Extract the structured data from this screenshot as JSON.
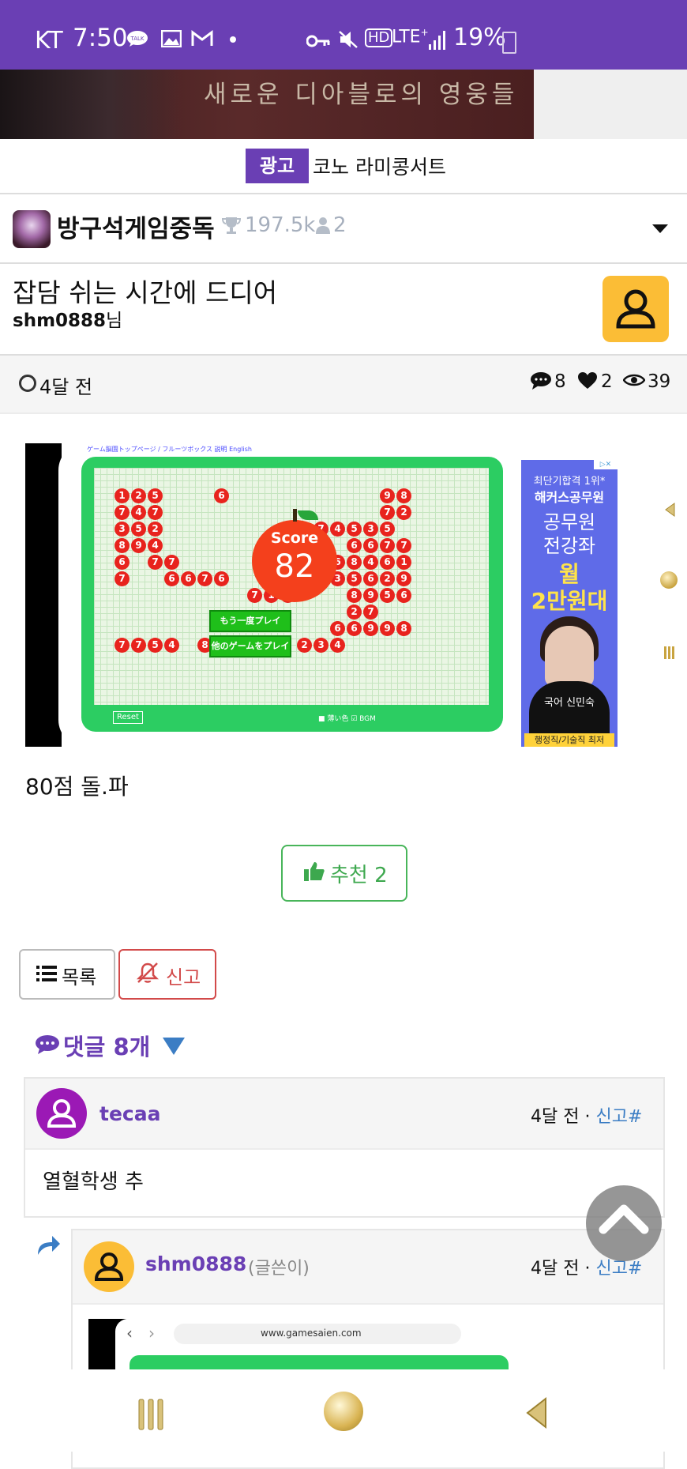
{
  "status_bar": {
    "carrier": "KT",
    "time": "7:50",
    "network": "HD LTE+",
    "battery": "19%"
  },
  "banner": {
    "text": "새로운 디아블로의 영웅들"
  },
  "ad_line": {
    "badge": "광고",
    "text": "코노 라미콩서트"
  },
  "board": {
    "name": "방구석게임중독",
    "score": "197.5k",
    "members": "2"
  },
  "post": {
    "title": "잡담 쉬는 시간에 드디어",
    "author": "shm0888",
    "author_suffix": "님",
    "time": "4달 전",
    "comments": "8",
    "likes": "2",
    "views": "39",
    "body": "80점 돌.파",
    "recommend_label": "추천 2"
  },
  "game_image": {
    "top_links": "ゲーム脳園トップページ / フルーツボックス   説明   English",
    "score_label": "Score",
    "score_value": "82",
    "button_play_again": "もう一度プレイ",
    "button_other_games": "他のゲームをプレイ",
    "reset": "Reset",
    "options": "■ 薄い色  ☑ BGM",
    "ad": {
      "line1": "최단기합격 1위*",
      "line2": "해커스공무원",
      "line3a": "공무원",
      "line3b": "전강좌",
      "line4a": "월",
      "line4b": "2만원대",
      "teacher": "국어 신민숙",
      "bottom": "행정직/기술직 최저"
    }
  },
  "actions": {
    "list_label": "목록",
    "report_label": "신고"
  },
  "comments_section": {
    "title": "댓글 8개",
    "items": [
      {
        "user": "tecaa",
        "time": "4달 전",
        "sep": "·",
        "report": "신고",
        "hash": "#",
        "text": "열혈학생 추"
      },
      {
        "user": "shm0888",
        "tag": "(글쓴이)",
        "time": "4달 전",
        "sep": "·",
        "report": "신고",
        "hash": "#",
        "url": "www.gamesaien.com"
      }
    ]
  },
  "colors": {
    "brand_purple": "#6a3fb4",
    "link_blue": "#3b7dc4",
    "user_yellow": "#fbbd36",
    "report_red": "#d24a4a",
    "recommend_green": "#3da84e",
    "game_green": "#2ccd62"
  },
  "icons": [
    "talk-icon",
    "gallery-icon",
    "gmail-icon",
    "key-icon",
    "mute-icon",
    "signal-icon",
    "battery-icon",
    "trophy-icon",
    "user-icon",
    "clock-icon",
    "comment-icon",
    "heart-icon",
    "eye-icon",
    "thumbs-up-icon",
    "list-icon",
    "report-icon",
    "reply-arrow-icon",
    "scroll-top-icon",
    "recent-apps-icon",
    "home-icon",
    "back-icon"
  ]
}
